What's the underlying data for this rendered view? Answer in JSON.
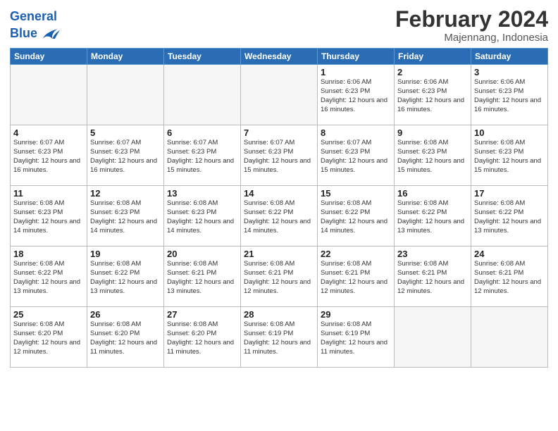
{
  "header": {
    "logo_line1": "General",
    "logo_line2": "Blue",
    "title": "February 2024",
    "subtitle": "Majennang, Indonesia"
  },
  "weekdays": [
    "Sunday",
    "Monday",
    "Tuesday",
    "Wednesday",
    "Thursday",
    "Friday",
    "Saturday"
  ],
  "weeks": [
    [
      {
        "day": "",
        "info": ""
      },
      {
        "day": "",
        "info": ""
      },
      {
        "day": "",
        "info": ""
      },
      {
        "day": "",
        "info": ""
      },
      {
        "day": "1",
        "info": "Sunrise: 6:06 AM\nSunset: 6:23 PM\nDaylight: 12 hours and 16 minutes."
      },
      {
        "day": "2",
        "info": "Sunrise: 6:06 AM\nSunset: 6:23 PM\nDaylight: 12 hours and 16 minutes."
      },
      {
        "day": "3",
        "info": "Sunrise: 6:06 AM\nSunset: 6:23 PM\nDaylight: 12 hours and 16 minutes."
      }
    ],
    [
      {
        "day": "4",
        "info": "Sunrise: 6:07 AM\nSunset: 6:23 PM\nDaylight: 12 hours and 16 minutes."
      },
      {
        "day": "5",
        "info": "Sunrise: 6:07 AM\nSunset: 6:23 PM\nDaylight: 12 hours and 16 minutes."
      },
      {
        "day": "6",
        "info": "Sunrise: 6:07 AM\nSunset: 6:23 PM\nDaylight: 12 hours and 15 minutes."
      },
      {
        "day": "7",
        "info": "Sunrise: 6:07 AM\nSunset: 6:23 PM\nDaylight: 12 hours and 15 minutes."
      },
      {
        "day": "8",
        "info": "Sunrise: 6:07 AM\nSunset: 6:23 PM\nDaylight: 12 hours and 15 minutes."
      },
      {
        "day": "9",
        "info": "Sunrise: 6:08 AM\nSunset: 6:23 PM\nDaylight: 12 hours and 15 minutes."
      },
      {
        "day": "10",
        "info": "Sunrise: 6:08 AM\nSunset: 6:23 PM\nDaylight: 12 hours and 15 minutes."
      }
    ],
    [
      {
        "day": "11",
        "info": "Sunrise: 6:08 AM\nSunset: 6:23 PM\nDaylight: 12 hours and 14 minutes."
      },
      {
        "day": "12",
        "info": "Sunrise: 6:08 AM\nSunset: 6:23 PM\nDaylight: 12 hours and 14 minutes."
      },
      {
        "day": "13",
        "info": "Sunrise: 6:08 AM\nSunset: 6:23 PM\nDaylight: 12 hours and 14 minutes."
      },
      {
        "day": "14",
        "info": "Sunrise: 6:08 AM\nSunset: 6:22 PM\nDaylight: 12 hours and 14 minutes."
      },
      {
        "day": "15",
        "info": "Sunrise: 6:08 AM\nSunset: 6:22 PM\nDaylight: 12 hours and 14 minutes."
      },
      {
        "day": "16",
        "info": "Sunrise: 6:08 AM\nSunset: 6:22 PM\nDaylight: 12 hours and 13 minutes."
      },
      {
        "day": "17",
        "info": "Sunrise: 6:08 AM\nSunset: 6:22 PM\nDaylight: 12 hours and 13 minutes."
      }
    ],
    [
      {
        "day": "18",
        "info": "Sunrise: 6:08 AM\nSunset: 6:22 PM\nDaylight: 12 hours and 13 minutes."
      },
      {
        "day": "19",
        "info": "Sunrise: 6:08 AM\nSunset: 6:22 PM\nDaylight: 12 hours and 13 minutes."
      },
      {
        "day": "20",
        "info": "Sunrise: 6:08 AM\nSunset: 6:21 PM\nDaylight: 12 hours and 13 minutes."
      },
      {
        "day": "21",
        "info": "Sunrise: 6:08 AM\nSunset: 6:21 PM\nDaylight: 12 hours and 12 minutes."
      },
      {
        "day": "22",
        "info": "Sunrise: 6:08 AM\nSunset: 6:21 PM\nDaylight: 12 hours and 12 minutes."
      },
      {
        "day": "23",
        "info": "Sunrise: 6:08 AM\nSunset: 6:21 PM\nDaylight: 12 hours and 12 minutes."
      },
      {
        "day": "24",
        "info": "Sunrise: 6:08 AM\nSunset: 6:21 PM\nDaylight: 12 hours and 12 minutes."
      }
    ],
    [
      {
        "day": "25",
        "info": "Sunrise: 6:08 AM\nSunset: 6:20 PM\nDaylight: 12 hours and 12 minutes."
      },
      {
        "day": "26",
        "info": "Sunrise: 6:08 AM\nSunset: 6:20 PM\nDaylight: 12 hours and 11 minutes."
      },
      {
        "day": "27",
        "info": "Sunrise: 6:08 AM\nSunset: 6:20 PM\nDaylight: 12 hours and 11 minutes."
      },
      {
        "day": "28",
        "info": "Sunrise: 6:08 AM\nSunset: 6:19 PM\nDaylight: 12 hours and 11 minutes."
      },
      {
        "day": "29",
        "info": "Sunrise: 6:08 AM\nSunset: 6:19 PM\nDaylight: 12 hours and 11 minutes."
      },
      {
        "day": "",
        "info": ""
      },
      {
        "day": "",
        "info": ""
      }
    ]
  ]
}
